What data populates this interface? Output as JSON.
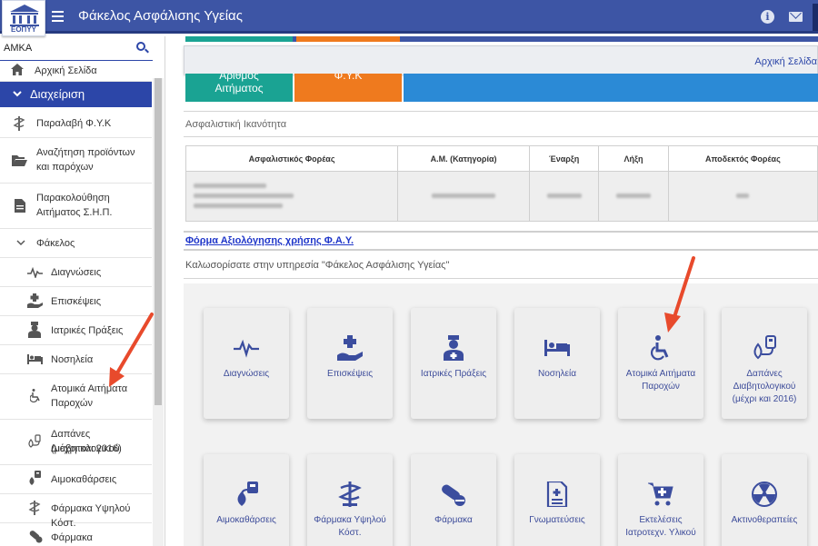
{
  "app": {
    "title": "Φάκελος Ασφάλισης Υγείας",
    "logo_text": "ΕΟΠΥΥ",
    "info_icon": "info-icon",
    "mail_icon": "mail-icon"
  },
  "sidebar": {
    "amka_label": "ΑΜΚΑ",
    "items": [
      {
        "label": "Αρχική Σελίδα",
        "icon": "home-icon"
      },
      {
        "label": "Διαχείριση",
        "icon": "chevron-down-icon"
      },
      {
        "label": "Παραλαβή Φ.Υ.Κ",
        "icon": "pharmacy-icon"
      },
      {
        "label": "Αναζήτηση προϊόντων",
        "label2": "και παρόχων",
        "icon": "folder-open-icon"
      },
      {
        "label": "Παρακολούθηση",
        "label2": "Αιτήματος Σ.Η.Π.",
        "icon": "document-icon"
      },
      {
        "label": "Φάκελος",
        "icon": "chevron-down-icon"
      },
      {
        "label": "Διαγνώσεις",
        "icon": "heartbeat-icon"
      },
      {
        "label": "Επισκέψεις",
        "icon": "hand-holding-medical-icon"
      },
      {
        "label": "Ιατρικές Πράξεις",
        "icon": "user-nurse-icon"
      },
      {
        "label": "Νοσηλεία",
        "icon": "bed-icon"
      },
      {
        "label": "Ατομικά Αιτήματα",
        "label2": "Παροχών",
        "icon": "wheelchair-icon"
      },
      {
        "label": "Δαπάνες Διαβητολογικού",
        "label2": "(μέχρι και 2016)",
        "icon": "diabetes-icon"
      },
      {
        "label": "Αιμοκαθάρσεις",
        "icon": "dialysis-icon"
      },
      {
        "label": "Φάρμακα Υψηλού Κόστ.",
        "icon": "caduceus-icon"
      },
      {
        "label": "Φάρμακα",
        "icon": "pills-icon"
      }
    ]
  },
  "main": {
    "breadcrumb": "Αρχική Σελίδα",
    "status_tiles": {
      "teal_line1": "Αριθμός",
      "teal_line2": "Αιτήματος",
      "orange_line1": "Φ.Υ.Κ"
    },
    "insurance_title": "Ασφαλιστική Ικανότητα",
    "table_headers": [
      "Ασφαλιστικός Φορέας",
      "Α.Μ. (Κατηγορία)",
      "Έναρξη",
      "Λήξη",
      "Αποδεκτός Φορέας"
    ],
    "form_link": "Φόρμα Αξιολόγησης χρήσης Φ.Α.Υ.",
    "welcome": "Καλωσορίσατε στην υπηρεσία \"Φάκελος Ασφάλισης Υγείας\"",
    "tiles": [
      {
        "label": "Διαγνώσεις",
        "icon": "heartbeat-icon"
      },
      {
        "label": "Επισκέψεις",
        "icon": "hand-holding-medical-icon"
      },
      {
        "label": "Ιατρικές Πράξεις",
        "icon": "user-nurse-icon"
      },
      {
        "label": "Νοσηλεία",
        "icon": "bed-icon"
      },
      {
        "label": "Ατομικά Αιτήματα Παροχών",
        "icon": "wheelchair-icon"
      },
      {
        "label": "Δαπάνες Διαβητολογικού (μέχρι και 2016)",
        "icon": "diabetes-icon"
      },
      {
        "label": "Αιμοκαθάρσεις",
        "icon": "dialysis-icon"
      },
      {
        "label": "Φάρμακα Υψηλού Κόστ.",
        "icon": "caduceus-icon"
      },
      {
        "label": "Φάρμακα",
        "icon": "pills-icon"
      },
      {
        "label": "Γνωματεύσεις",
        "icon": "document-icon"
      },
      {
        "label": "Εκτελέσεις Ιατροτεχν. Υλικού",
        "icon": "cart-medical-icon"
      },
      {
        "label": "Ακτινοθεραπείες",
        "icon": "radiation-icon"
      }
    ]
  },
  "colors": {
    "header_blue": "#3d55a5",
    "active_blue": "#2c46a8",
    "teal": "#1aa393",
    "orange": "#ef7a1e",
    "sky_blue": "#2b8ad6",
    "annotation_red": "#e84a2c"
  }
}
